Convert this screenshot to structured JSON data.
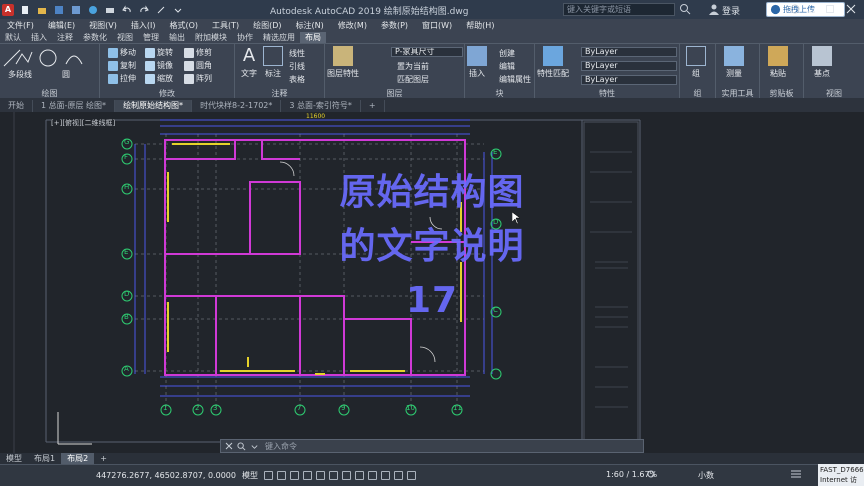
{
  "window": {
    "title": "Autodesk AutoCAD 2019    绘制原始结构图.dwg",
    "search_placeholder": "键入关键字或短语",
    "login_label": "登录",
    "share_label": "拖拽上传"
  },
  "menu": [
    "文件(F)",
    "编辑(E)",
    "视图(V)",
    "插入(I)",
    "格式(O)",
    "工具(T)",
    "绘图(D)",
    "标注(N)",
    "修改(M)",
    "参数(P)",
    "窗口(W)",
    "帮助(H)"
  ],
  "ribbon_tabs": [
    "默认",
    "插入",
    "注释",
    "参数化",
    "视图",
    "管理",
    "输出",
    "附加模块",
    "协作",
    "精选应用",
    "布局"
  ],
  "ribbon_active_tab": "布局",
  "ribbon": {
    "draw": {
      "caption": "绘图",
      "polyline": "多段线",
      "circle": "圆"
    },
    "modify": {
      "caption": "修改",
      "move": "移动",
      "rotate": "旋转",
      "trim": "修剪",
      "copy": "复制",
      "mirror": "镜像",
      "fillet": "圆角",
      "stretch": "拉伸",
      "scale": "缩放",
      "array": "阵列"
    },
    "annotation": {
      "caption": "注释",
      "text": "文字",
      "dimension": "标注",
      "linear": "线性",
      "leader": "引线",
      "table": "表格"
    },
    "layers": {
      "caption": "图层",
      "layer_props": "图层特性",
      "current_layer": "P-家具尺寸",
      "make_current": "置为当前",
      "match_layer": "匹配图层"
    },
    "block": {
      "caption": "块",
      "insert": "插入",
      "create": "创建",
      "edit": "编辑",
      "edit_attr": "编辑属性"
    },
    "properties": {
      "caption": "特性",
      "match": "特性匹配",
      "color": "ByLayer",
      "linetype": "ByLayer",
      "lineweight": "ByLayer"
    },
    "groups": {
      "caption": "组",
      "group": "组"
    },
    "utilities": {
      "caption": "实用工具",
      "measure": "测量"
    },
    "clipboard": {
      "caption": "剪贴板",
      "paste": "粘贴"
    },
    "view": {
      "caption": "视图",
      "base": "基点"
    }
  },
  "doc_tabs": [
    "开始",
    "1 总面-原层  绘图*",
    "绘制原始结构图*",
    "时代块样8-2-1702*",
    "3 总面-索引符号*"
  ],
  "doc_active": "绘制原始结构图*",
  "viewport_label": "[+][俯视][二维线框]",
  "overlay": {
    "line1": "原始结构图",
    "line2": "的文字说明",
    "line3": "17"
  },
  "drawing": {
    "row_labels": [
      "G",
      "F",
      "H",
      "E",
      "D",
      "B",
      "A"
    ],
    "col_labels": [
      "1",
      "2",
      "3",
      "7",
      "9",
      "10",
      "11"
    ],
    "right_labels": [
      "E",
      "D",
      "C"
    ],
    "top_dim": "11600"
  },
  "command_placeholder": "键入命令",
  "layout_tabs": [
    "模型",
    "布局1",
    "布局2"
  ],
  "layout_active": "布局2",
  "status": {
    "coords": "447276.2677, 46502.8707, 0.0000",
    "model": "模型",
    "scale": "1:60 / 1.67%",
    "units": "小数"
  },
  "tray": {
    "line1": "FAST_D7666C",
    "line2": "Internet 访问"
  }
}
